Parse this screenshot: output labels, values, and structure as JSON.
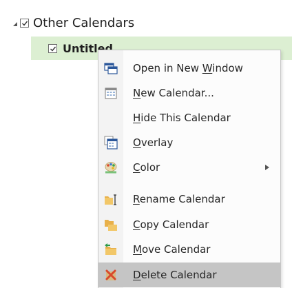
{
  "tree": {
    "group_label": "Other Calendars",
    "calendar_label": "Untitled"
  },
  "menu": {
    "items": [
      {
        "pre": "Open in New ",
        "acc": "W",
        "post": "indow",
        "icon": "open-window-icon"
      },
      {
        "pre": "",
        "acc": "N",
        "post": "ew Calendar...",
        "icon": "new-calendar-icon"
      },
      {
        "pre": "",
        "acc": "H",
        "post": "ide This Calendar",
        "icon": ""
      },
      {
        "pre": "",
        "acc": "O",
        "post": "verlay",
        "icon": "overlay-icon"
      },
      {
        "pre": "",
        "acc": "C",
        "post": "olor",
        "icon": "color-icon"
      },
      {
        "pre": "",
        "acc": "R",
        "post": "ename Calendar",
        "icon": "rename-icon"
      },
      {
        "pre": "",
        "acc": "C",
        "post": "opy Calendar",
        "icon": "copy-calendar-icon"
      },
      {
        "pre": "",
        "acc": "M",
        "post": "ove Calendar",
        "icon": "move-calendar-icon"
      },
      {
        "pre": "",
        "acc": "D",
        "post": "elete Calendar",
        "icon": "delete-icon"
      }
    ]
  },
  "colors": {
    "selection_green": "#dcefd2",
    "menu_hover": "#c5c5c5",
    "delete_red": "#d9482b"
  }
}
